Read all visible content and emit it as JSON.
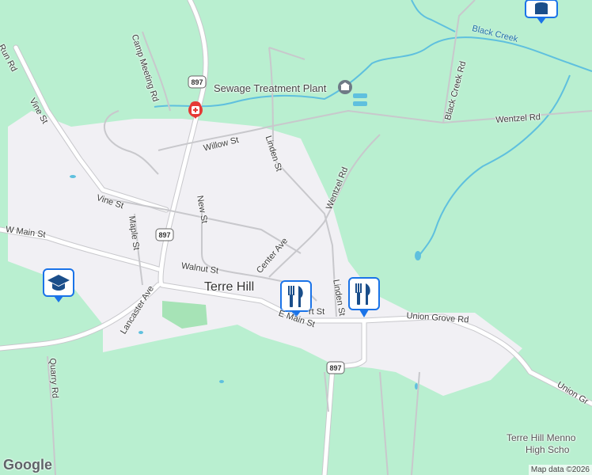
{
  "map": {
    "colors": {
      "land": "#b9efd0",
      "town": "#f1f0f4",
      "road": "#ffffff",
      "road_border": "#c8c8cc",
      "water": "#5fc0de",
      "park": "#a6e3b6",
      "marker": "#1a73e8",
      "hospital": "#e53935"
    },
    "town_label": "Terre Hill",
    "route_shields": [
      "897",
      "897",
      "897"
    ],
    "streets": {
      "camp_meeting": "Camp Meeting Rd",
      "willow": "Willow St",
      "vine_upper": "Vine St",
      "vine_lower": "Vine St",
      "run": "Run Rd",
      "linden_upper": "Linden St",
      "linden_lower": "Linden St",
      "wentzel_upper": "Wentzel Rd",
      "wentzel_lower": "Wentzel Rd",
      "black_creek_rd": "Black Creek Rd",
      "new": "New St",
      "maple": "Maple St",
      "w_main": "W Main St",
      "walnut": "Walnut St",
      "center": "Center Ave",
      "lancaster": "Lancaster Ave",
      "e_main": "E Main St",
      "union_grove": "Union Grove Rd",
      "union_grove_2": "Union Gr",
      "quarry": "Quarry Rd",
      "short": "rt St"
    },
    "poi": {
      "sewage": "Sewage Treatment Plant",
      "black_creek": "Black Creek",
      "school_line1": "Terre Hill Menno",
      "school_line2": "High Scho"
    },
    "markers": [
      {
        "name": "restaurant-marker-1",
        "icon": "fork-knife-icon"
      },
      {
        "name": "restaurant-marker-2",
        "icon": "fork-knife-icon"
      },
      {
        "name": "school-marker",
        "icon": "graduation-cap-icon"
      },
      {
        "name": "top-right-marker",
        "icon": "building-icon"
      },
      {
        "name": "hospital-marker",
        "icon": "hospital-icon"
      }
    ],
    "branding": "Google",
    "attribution": "Map data ©2026"
  }
}
